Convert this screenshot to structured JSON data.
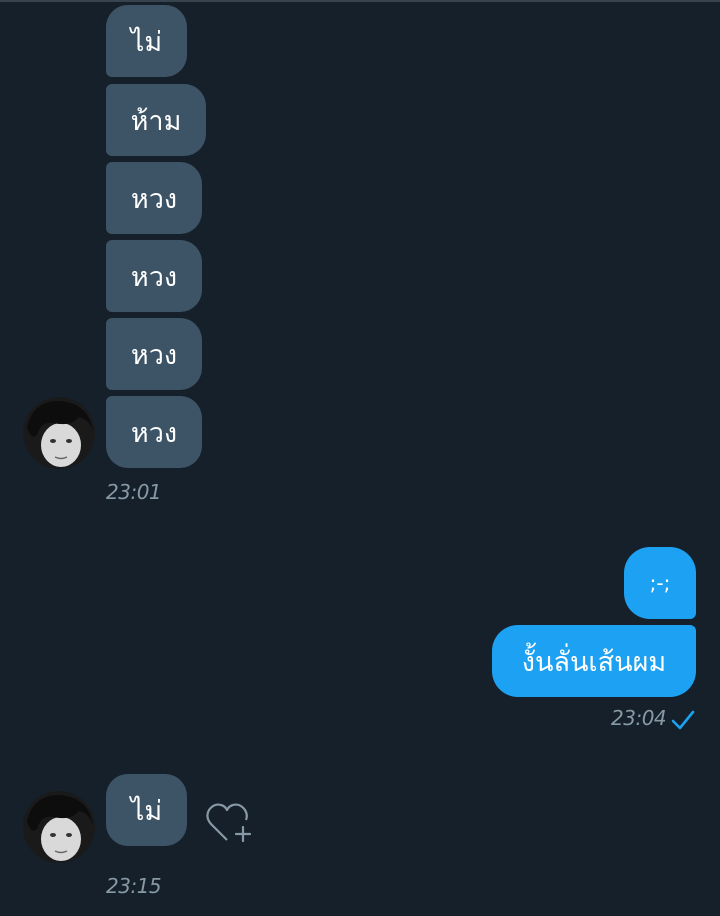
{
  "conversation": {
    "group1": {
      "messages": [
        "ไม่",
        "ห้าม",
        "หวง",
        "หวง",
        "หวง",
        "หวง"
      ],
      "time": "23:01"
    },
    "group2": {
      "messages": [
        ";-;",
        "งั้นลั่นเส้นผม"
      ],
      "time": "23:04",
      "status_icon": "check-icon"
    },
    "group3": {
      "messages": [
        "ไม่"
      ],
      "time": "23:15",
      "reaction_icon": "heart-add-icon"
    }
  },
  "colors": {
    "background": "#15202b",
    "incoming_bubble": "#3d5466",
    "outgoing_bubble": "#1da1f2",
    "timestamp": "#8899a6",
    "check": "#1da1f2"
  }
}
